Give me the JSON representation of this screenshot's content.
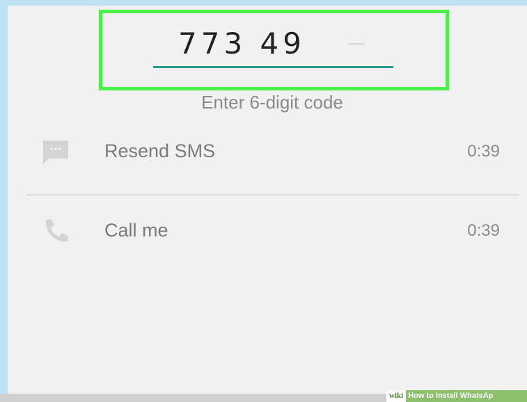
{
  "verification": {
    "code_entered": "773 49",
    "hint": "Enter 6-digit code"
  },
  "options": [
    {
      "label": "Resend SMS",
      "timer": "0:39",
      "icon": "sms-icon"
    },
    {
      "label": "Call me",
      "timer": "0:39",
      "icon": "phone-icon"
    }
  ],
  "watermark": {
    "brand": "wiki",
    "text": "How to Install WhatsAp"
  },
  "colors": {
    "highlight_box": "#4cf04a",
    "underline": "#2a9a91",
    "background": "#f1f1f1"
  }
}
